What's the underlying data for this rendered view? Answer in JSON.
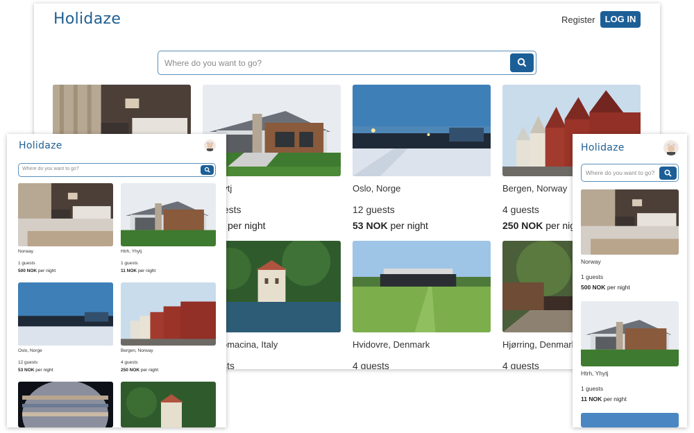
{
  "brand": "Holidaze",
  "search_placeholder": "Where do you want to go?",
  "nav": {
    "register": "Register",
    "login": "LOG IN"
  },
  "price_suffix": "per night",
  "icons": {
    "search": "search-icon",
    "avatar": "user-avatar"
  },
  "colors": {
    "brand": "#1f5f91",
    "button": "#1c5f97"
  },
  "desktop": {
    "cards_row1": [
      {
        "location": "",
        "guests": "",
        "price": "",
        "img": "bedroom"
      },
      {
        "location": "hytj",
        "guests": "uests",
        "price": "K",
        "img": "house"
      },
      {
        "location": "Oslo, Norge",
        "guests": "12 guests",
        "price": "53 NOK",
        "img": "harbor"
      },
      {
        "location": "Bergen, Norway",
        "guests": "4 guests",
        "price": "250 NOK",
        "img": "bergen"
      }
    ],
    "cards_row2": [
      {
        "location": "omacina, Italy",
        "guests": "sts",
        "img": "villa"
      },
      {
        "location": "Hvidovre, Denmark",
        "guests": "4 guests",
        "img": "field"
      },
      {
        "location": "Hjørring, Denmark",
        "guests": "4 guests",
        "img": "garden"
      }
    ]
  },
  "tablet": {
    "cards": [
      {
        "location": "Norway",
        "guests": "1 guests",
        "price": "500 NOK",
        "img": "bedroom"
      },
      {
        "location": "Htrh, Yhytj",
        "guests": "1 guests",
        "price": "11 NOK",
        "img": "house"
      },
      {
        "location": "Oslo, Norge",
        "guests": "12 guests",
        "price": "53 NOK",
        "img": "harbor"
      },
      {
        "location": "Bergen, Norway",
        "guests": "4 guests",
        "price": "250 NOK",
        "img": "bergen"
      },
      {
        "img": "jupiter"
      },
      {
        "img": "villa"
      }
    ]
  },
  "phone": {
    "cards": [
      {
        "location": "Norway",
        "guests": "1 guests",
        "price": "500 NOK",
        "img": "bedroom"
      },
      {
        "location": "Htrh, Yhytj",
        "guests": "1 guests",
        "price": "11 NOK",
        "img": "house"
      },
      {
        "img": "harbor"
      }
    ]
  }
}
